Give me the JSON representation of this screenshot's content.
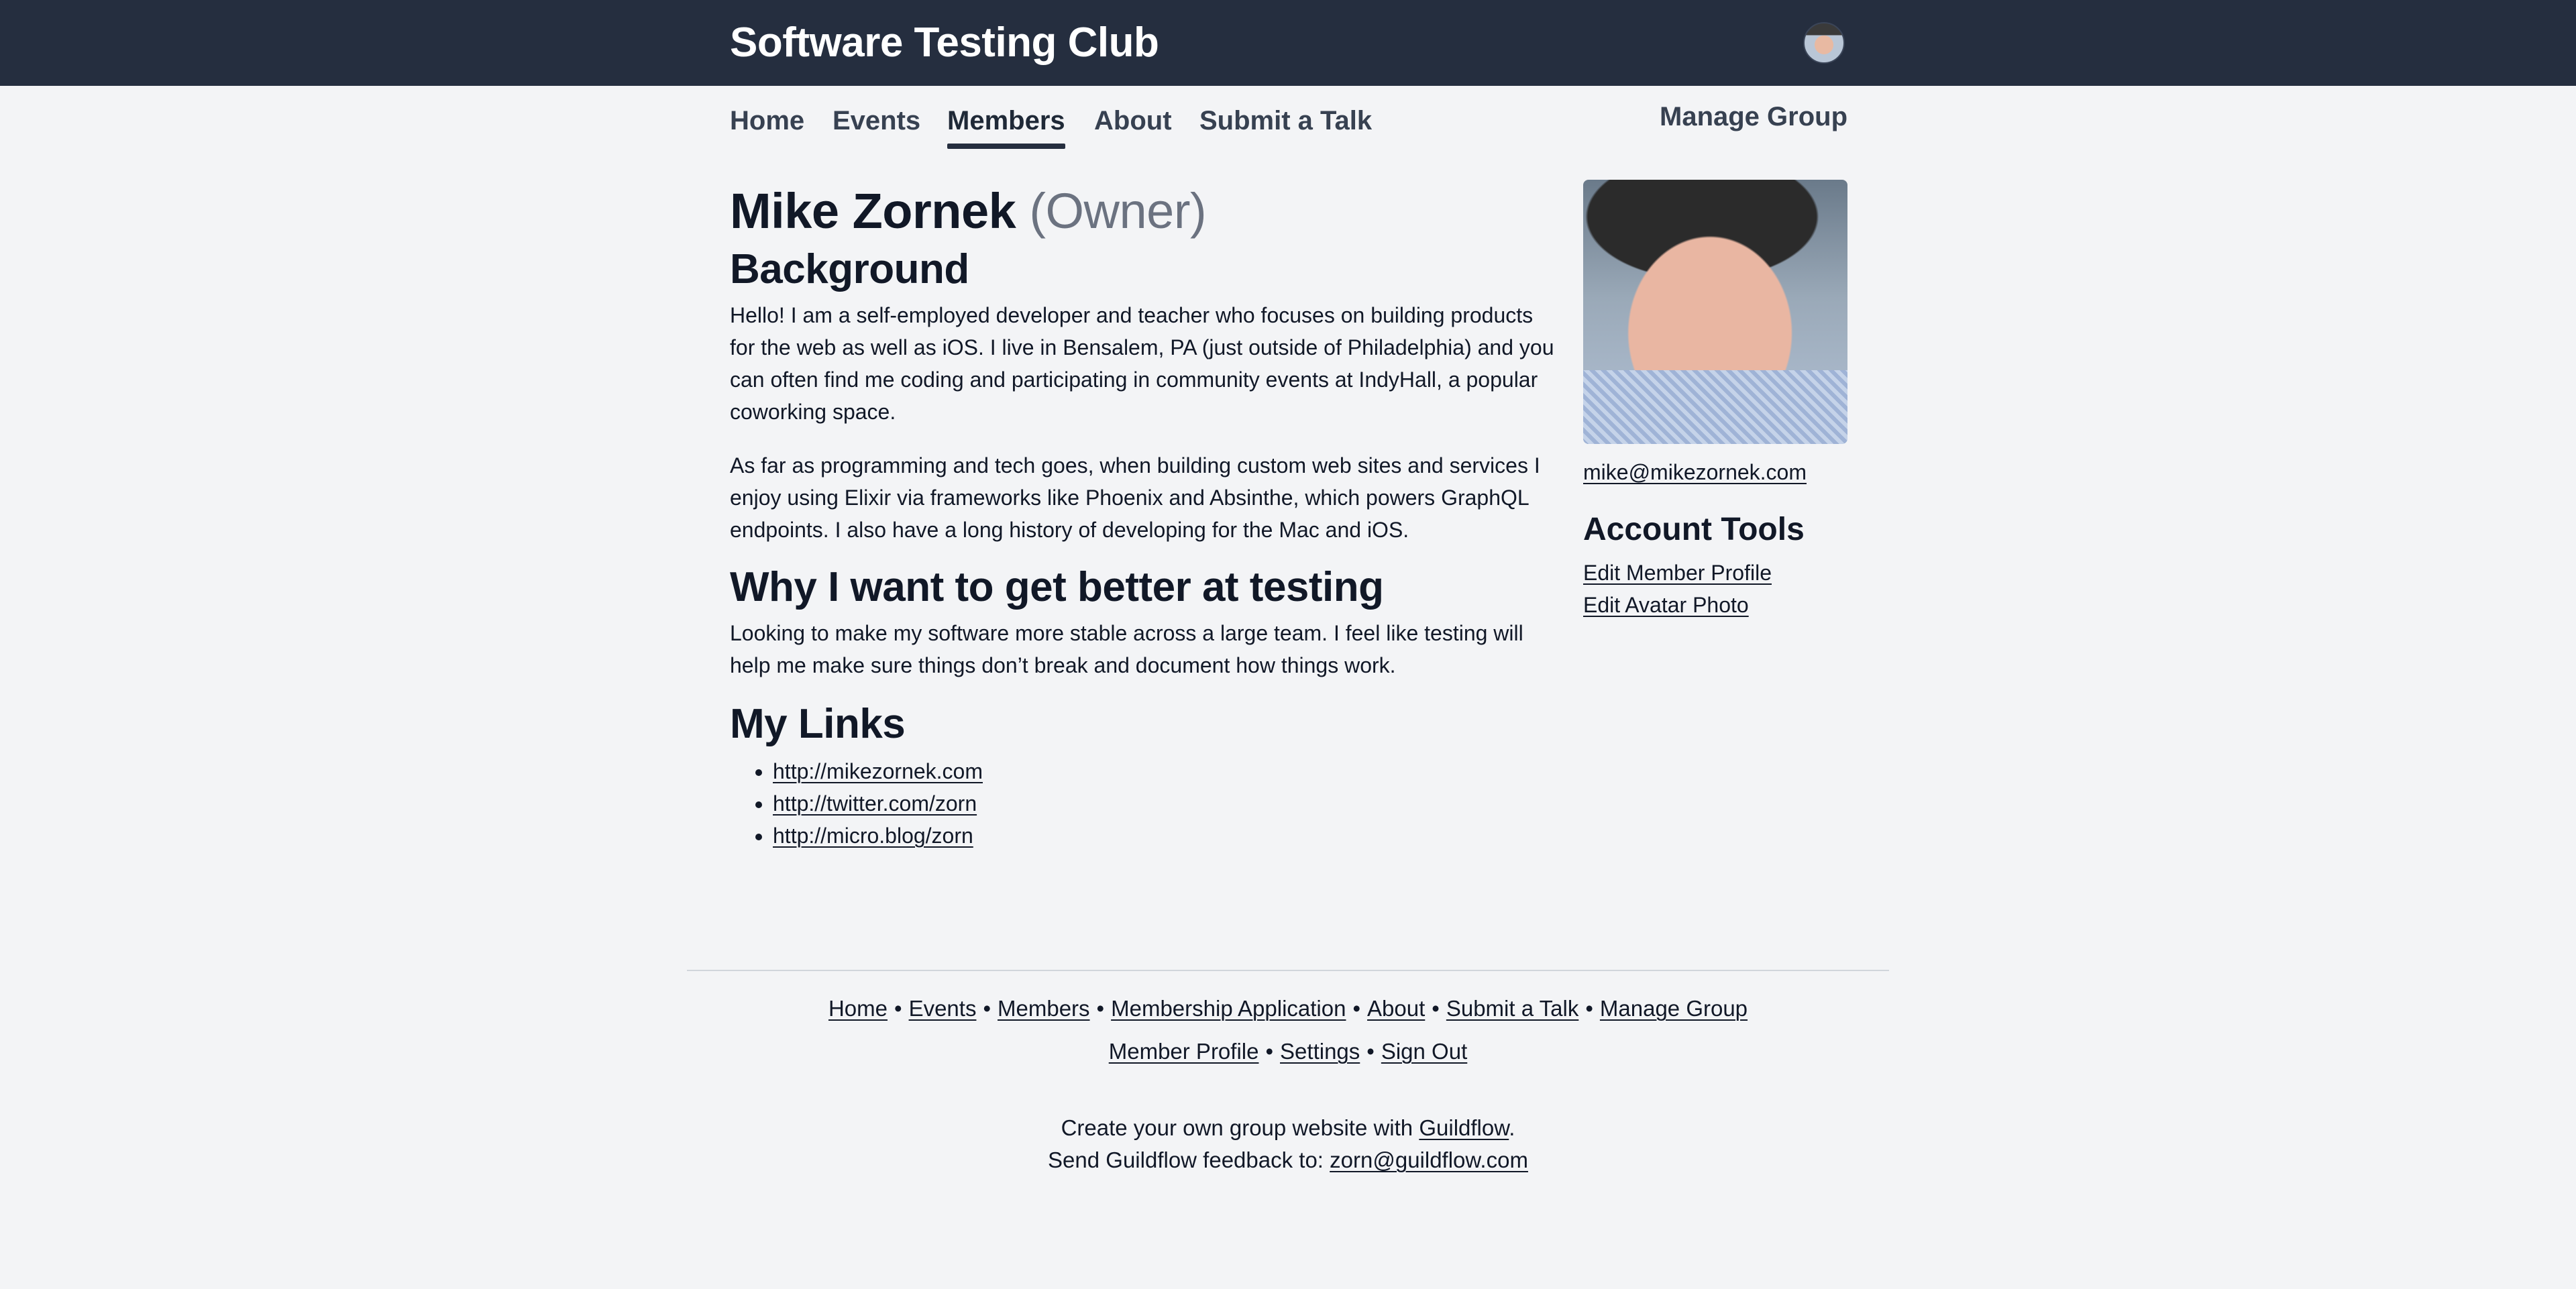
{
  "header": {
    "site_title": "Software Testing Club",
    "avatar_icon": "user-avatar"
  },
  "nav": {
    "items": [
      {
        "label": "Home"
      },
      {
        "label": "Events"
      },
      {
        "label": "Members",
        "active": true
      },
      {
        "label": "About"
      },
      {
        "label": "Submit a Talk"
      }
    ],
    "manage_group": "Manage Group"
  },
  "member": {
    "name": "Mike Zornek",
    "role": "(Owner)",
    "background_heading": "Background",
    "background_p1": "Hello! I am a self-employed developer and teacher who focuses on building products for the web as well as iOS. I live in Bensalem, PA (just outside of Philadelphia) and you can often find me coding and participating in community events at IndyHall, a popular coworking space.",
    "background_p2": "As far as programming and tech goes, when building custom web sites and services I enjoy using Elixir via frameworks like Phoenix and Absinthe, which powers GraphQL endpoints. I also have a long history of developing for the Mac and iOS.",
    "why_heading": "Why I want to get better at testing",
    "why_text": "Looking to make my software more stable across a large team. I feel like testing will help me make sure things don’t break and document how things work.",
    "links_heading": "My Links",
    "links": [
      "http://mikezornek.com",
      "http://twitter.com/zorn",
      "http://micro.blog/zorn"
    ]
  },
  "sidebar": {
    "email": "mike@mikezornek.com",
    "tools_heading": "Account Tools",
    "edit_profile": "Edit Member Profile",
    "edit_avatar": "Edit Avatar Photo"
  },
  "footer": {
    "row1": [
      "Home",
      "Events",
      "Members",
      "Membership Application",
      "About",
      "Submit a Talk",
      "Manage Group"
    ],
    "row2": [
      "Member Profile",
      "Settings",
      "Sign Out"
    ],
    "separator": "•",
    "create_prefix": "Create your own group website with ",
    "create_link": "Guildflow",
    "create_suffix": ".",
    "feedback_prefix": "Send Guildflow feedback to: ",
    "feedback_link": "zorn@guildflow.com"
  },
  "colors": {
    "header_bg": "#252e3f",
    "page_bg": "#f3f4f6",
    "muted_text": "#6b7280"
  }
}
